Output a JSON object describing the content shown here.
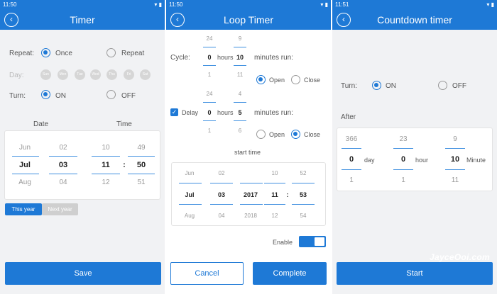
{
  "timer": {
    "status_time": "11:50",
    "title": "Timer",
    "repeat_label": "Repeat:",
    "once": "Once",
    "repeat": "Repeat",
    "day_label": "Day:",
    "days": [
      "Sun",
      "Mon",
      "Tue",
      "Wed",
      "Thu",
      "Fri",
      "Sat"
    ],
    "turn_label": "Turn:",
    "on": "ON",
    "off": "OFF",
    "date_label": "Date",
    "time_label": "Time",
    "month_prev": "Jun",
    "month_sel": "Jul",
    "month_next": "Aug",
    "dayn_prev": "02",
    "dayn_sel": "03",
    "dayn_next": "04",
    "hour_prev": "10",
    "hour_sel": "11",
    "hour_next": "12",
    "min_prev": "49",
    "min_sel": "50",
    "min_next": "51",
    "colon": ":",
    "this_year": "This year",
    "next_year": "Next year",
    "save": "Save"
  },
  "loop": {
    "status_time": "11:50",
    "title": "Loop Timer",
    "cycle_label": "Cycle:",
    "cycle_h_prev": "24",
    "cycle_h_sel": "0",
    "cycle_h_next": "1",
    "hours": "hours",
    "cycle_m_prev": "9",
    "cycle_m_sel": "10",
    "cycle_m_next": "11",
    "minutes_run": "minutes run:",
    "open": "Open",
    "close": "Close",
    "delay_label": "Delay",
    "delay_h_prev": "24",
    "delay_h_sel": "0",
    "delay_h_next": "1",
    "delay_m_prev": "4",
    "delay_m_sel": "5",
    "delay_m_next": "6",
    "start_time": "start time",
    "st_month": [
      "Jun",
      "Jul",
      "Aug"
    ],
    "st_day": [
      "02",
      "03",
      "04"
    ],
    "st_year": [
      "",
      "2017",
      "2018"
    ],
    "st_hour": [
      "10",
      "11",
      "12"
    ],
    "st_min": [
      "52",
      "53",
      "54"
    ],
    "colon": ":",
    "enable": "Enable",
    "cancel": "Cancel",
    "complete": "Complete",
    "check": "✓"
  },
  "countdown": {
    "status_time": "11:51",
    "title": "Countdown timer",
    "turn_label": "Turn:",
    "on": "ON",
    "off": "OFF",
    "after": "After",
    "day_prev": "366",
    "day_sel": "0",
    "day_next": "1",
    "day_unit": "day",
    "hour_prev": "23",
    "hour_sel": "0",
    "hour_next": "1",
    "hour_unit": "hour",
    "min_prev": "9",
    "min_sel": "10",
    "min_next": "11",
    "min_unit": "Minute",
    "start": "Start"
  },
  "watermark": "JayceOoi.com",
  "icons": {
    "back": "back-arrow-icon",
    "check": "checkbox-icon"
  },
  "colors": {
    "accent": "#1e79d6",
    "panel_bg": "#f1f2f4"
  }
}
